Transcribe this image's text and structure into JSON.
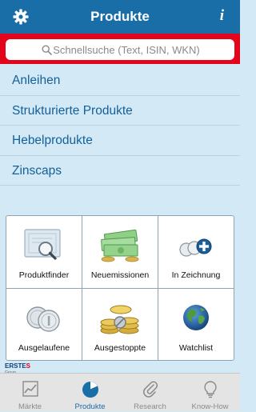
{
  "header": {
    "title": "Produkte",
    "info_glyph": "i",
    "left_icon": "gear-icon"
  },
  "search": {
    "placeholder": "Schnellsuche (Text, ISIN, WKN)",
    "value": ""
  },
  "categories": [
    "Anleihen",
    "Strukturierte Produkte",
    "Hebelprodukte",
    "Zinscaps"
  ],
  "grid": [
    {
      "label": "Produktfinder",
      "icon": "certificate-magnifier-icon"
    },
    {
      "label": "Neuemissionen",
      "icon": "banknotes-icon"
    },
    {
      "label": "In Zeichnung",
      "icon": "coins-plus-icon"
    },
    {
      "label": "Ausgelaufene",
      "icon": "silver-coins-icon"
    },
    {
      "label": "Ausgestoppte",
      "icon": "gold-coins-stop-icon"
    },
    {
      "label": "Watchlist",
      "icon": "globe-icon"
    }
  ],
  "brand": {
    "name_part1": "ERSTE",
    "symbol": "S",
    "sub": "Group"
  },
  "tabs": [
    {
      "label": "Märkte",
      "icon": "chart-icon",
      "active": false
    },
    {
      "label": "Produkte",
      "icon": "pie-chart-icon",
      "active": true
    },
    {
      "label": "Research",
      "icon": "paperclip-icon",
      "active": false
    },
    {
      "label": "Know-How",
      "icon": "lightbulb-icon",
      "active": false
    }
  ],
  "colors": {
    "header": "#1a6ea8",
    "search_bar": "#e2051c",
    "background": "#d3e9f5",
    "link": "#14609a"
  }
}
